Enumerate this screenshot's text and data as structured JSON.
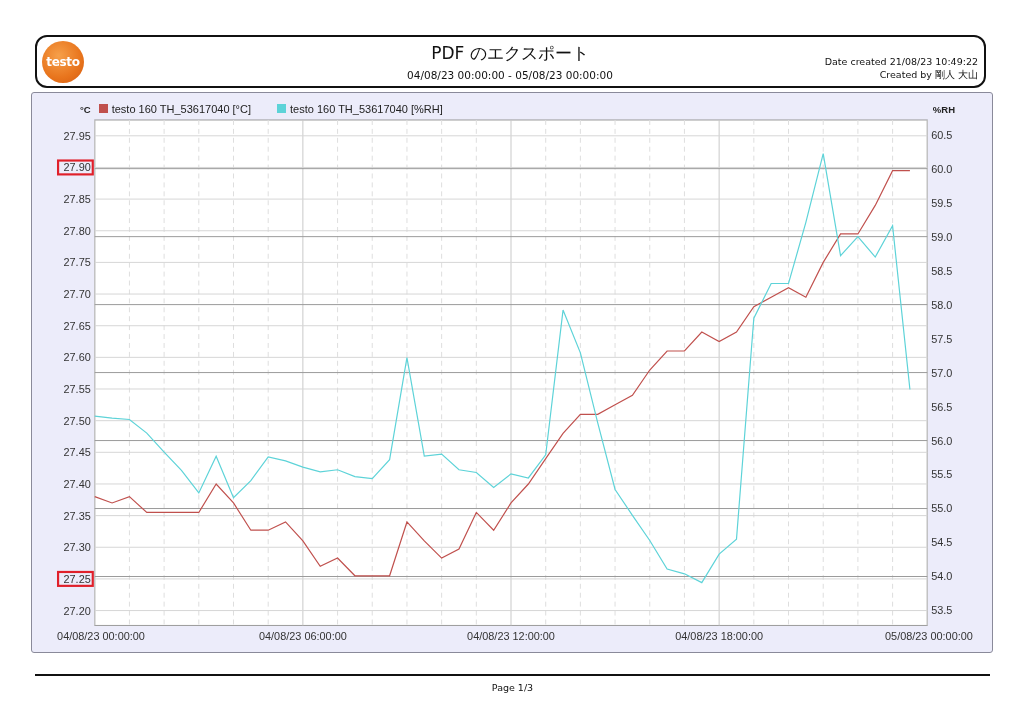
{
  "header": {
    "logo": "testo",
    "title": "PDF のエクスポート",
    "range": "04/08/23 00:00:00 - 05/08/23 00:00:00",
    "date_created": "Date created 21/08/23 10:49:22",
    "created_by": "Created by 剛人 大山"
  },
  "chart": {
    "chart_data": {
      "type": "line",
      "ylabel": "°C",
      "y2label": "%RH",
      "categories": [
        "04/08/23 00:00:00",
        null,
        null,
        null,
        null,
        null,
        null,
        null,
        null,
        null,
        null,
        null,
        "04/08/23 06:00:00",
        null,
        null,
        null,
        null,
        null,
        null,
        null,
        null,
        null,
        null,
        null,
        "04/08/23 12:00:00",
        null,
        null,
        null,
        null,
        null,
        null,
        null,
        null,
        null,
        null,
        null,
        "04/08/23 18:00:00",
        null,
        null,
        null,
        null,
        null,
        null,
        null,
        null,
        null,
        null,
        null,
        "05/08/23 00:00:00"
      ],
      "series": [
        {
          "name": "testo 160 TH_53617040 [°C]",
          "color": "#c0504d",
          "values": [
            27.38,
            27.37,
            27.38,
            27.355,
            27.355,
            27.355,
            27.355,
            27.4,
            27.37,
            27.327,
            27.327,
            27.34,
            27.31,
            27.27,
            27.283,
            27.255,
            27.255,
            27.255,
            27.34,
            27.31,
            27.283,
            27.297,
            27.355,
            27.327,
            27.37,
            27.4,
            27.44,
            27.48,
            27.51,
            27.51,
            27.525,
            27.54,
            27.58,
            27.61,
            27.61,
            27.64,
            27.625,
            27.64,
            27.68,
            27.695,
            27.71,
            27.695,
            27.75,
            27.795,
            27.795,
            27.84,
            27.895,
            27.895,
            null
          ]
        },
        {
          "name": "testo 160 TH_53617040 [%RH]",
          "color": "#5dd3d8",
          "axis": "y2",
          "values": [
            56.36,
            56.33,
            56.31,
            56.11,
            55.83,
            55.56,
            55.23,
            55.77,
            55.16,
            55.41,
            55.76,
            55.7,
            55.61,
            55.54,
            55.57,
            55.47,
            55.44,
            55.72,
            57.22,
            55.77,
            55.8,
            55.57,
            55.53,
            55.31,
            55.51,
            55.45,
            55.79,
            57.92,
            57.29,
            56.26,
            55.28,
            54.9,
            54.53,
            54.11,
            54.04,
            53.91,
            54.33,
            54.55,
            57.8,
            58.31,
            58.31,
            59.21,
            60.22,
            58.72,
            59.0,
            58.7,
            59.16,
            56.75,
            null
          ]
        }
      ],
      "ylim": [
        27.1765,
        27.975
      ],
      "grid": true,
      "y2lim": [
        53.28,
        60.716
      ],
      "yticks": [
        {
          "value": 27.2,
          "label": "27.20"
        },
        {
          "value": 27.25,
          "label": "27.25"
        },
        {
          "value": 27.3,
          "label": "27.30"
        },
        {
          "value": 27.35,
          "label": "27.35"
        },
        {
          "value": 27.4,
          "label": "27.40"
        },
        {
          "value": 27.45,
          "label": "27.45"
        },
        {
          "value": 27.5,
          "label": "27.50"
        },
        {
          "value": 27.55,
          "label": "27.55"
        },
        {
          "value": 27.6,
          "label": "27.60"
        },
        {
          "value": 27.65,
          "label": "27.65"
        },
        {
          "value": 27.7,
          "label": "27.70"
        },
        {
          "value": 27.75,
          "label": "27.75"
        },
        {
          "value": 27.8,
          "label": "27.80"
        },
        {
          "value": 27.85,
          "label": "27.85"
        },
        {
          "value": 27.9,
          "label": "27.90"
        },
        {
          "value": 27.95,
          "label": "27.95"
        }
      ],
      "y2ticks": [
        {
          "value": 53.5,
          "label": "53.5"
        },
        {
          "value": 54,
          "label": "54.0"
        },
        {
          "value": 54.5,
          "label": "54.5"
        },
        {
          "value": 55,
          "label": "55.0"
        },
        {
          "value": 55.5,
          "label": "55.5"
        },
        {
          "value": 56,
          "label": "56.0"
        },
        {
          "value": 56.5,
          "label": "56.5"
        },
        {
          "value": 57,
          "label": "57.0"
        },
        {
          "value": 57.5,
          "label": "57.5"
        },
        {
          "value": 58,
          "label": "58.0"
        },
        {
          "value": 58.5,
          "label": "58.5"
        },
        {
          "value": 59,
          "label": "59.0"
        },
        {
          "value": 59.5,
          "label": "59.5"
        },
        {
          "value": 60,
          "label": "60.0"
        },
        {
          "value": 60.5,
          "label": "60.5"
        }
      ]
    },
    "ytick_highlights": [
      {
        "on": false
      },
      {
        "on": true
      },
      {
        "on": false
      },
      {
        "on": false
      },
      {
        "on": false
      },
      {
        "on": false
      },
      {
        "on": false
      },
      {
        "on": false
      },
      {
        "on": false
      },
      {
        "on": false
      },
      {
        "on": false
      },
      {
        "on": false
      },
      {
        "on": false
      },
      {
        "on": false
      },
      {
        "on": true
      },
      {
        "on": false
      }
    ]
  },
  "footer": {
    "page": "Page 1/3"
  }
}
